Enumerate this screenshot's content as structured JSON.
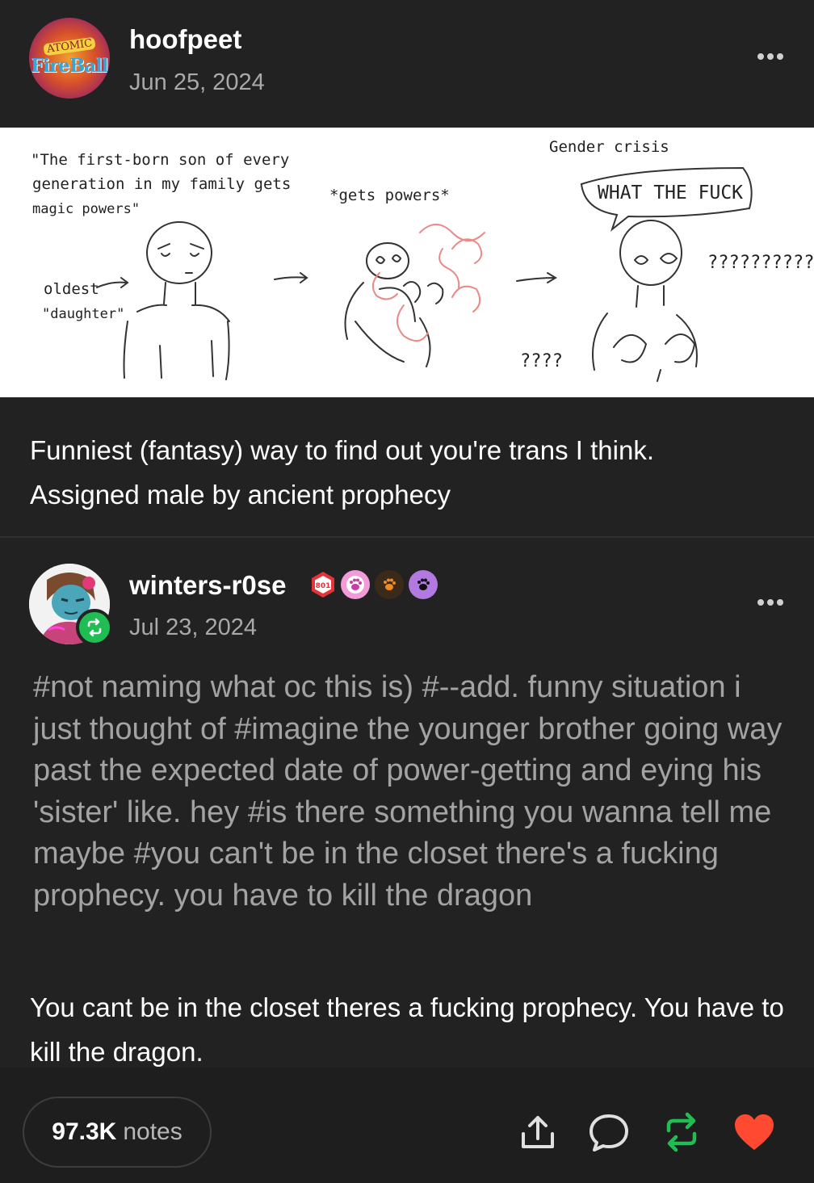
{
  "post": {
    "username": "hoofpeet",
    "date": "Jun 25, 2024",
    "avatar_text_top": "ATOMIC",
    "avatar_text_main": "FireBall",
    "caption_line1": "Funniest (fantasy) way to find out you're trans I think.",
    "caption_line2": "Assigned male by ancient prophecy"
  },
  "comic": {
    "panel1_quote_l1": "\"The first-born son of every",
    "panel1_quote_l2": "generation in my family gets",
    "panel1_quote_l3": "magic powers\"",
    "panel1_label_l1": "oldest",
    "panel1_label_l2": "\"daughter\"",
    "panel2_caption": "*gets powers*",
    "panel3_caption": "Gender crisis",
    "panel3_speech": "WHAT THE FUCK",
    "panel3_question": "??????????",
    "panel2_question": "????"
  },
  "reblog": {
    "username": "winters-r0se",
    "date": "Jul 23, 2024",
    "badge_label": "801",
    "tags": "#not naming what oc this is)  #--add. funny situation i just thought of  #imagine the younger brother going way past the expected date of power-getting and eying his 'sister' like. hey  #is there something you wanna tell me maybe  #you can't be in the closet there's a fucking prophecy. you have to kill the dragon",
    "reply_text": "You cant be in the closet theres a fucking prophecy. You have to kill the dragon."
  },
  "footer": {
    "notes_count": "97.3K",
    "notes_label": "notes"
  },
  "icons": {
    "more": "more-dots-icon",
    "share": "share-icon",
    "reply": "reply-bubble-icon",
    "reblog": "reblog-icon",
    "like": "heart-icon"
  },
  "colors": {
    "background": "#222222",
    "reblog_green": "#1fbd54",
    "heart_red": "#ff4930",
    "tag_gray": "#a3a3a3"
  }
}
